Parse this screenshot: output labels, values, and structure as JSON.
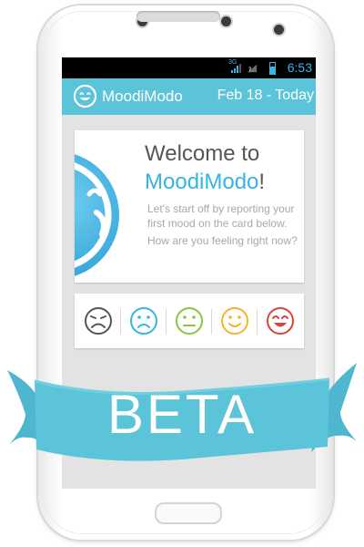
{
  "status_bar": {
    "network": "3G",
    "time": "6:53",
    "color": "#33b5e5"
  },
  "app_bar": {
    "title": "MoodiModo",
    "date": "Feb 18 - Today",
    "color": "#5cc4d8",
    "icon": "smiley-logo-icon"
  },
  "welcome_card": {
    "title_line1": "Welcome to",
    "title_app": "MoodiModo",
    "title_punct": "!",
    "body_line1": "Let's start off by reporting your first mood on the card below.",
    "body_line2": "How are you feeling right now?",
    "icon": "big-smiley-icon"
  },
  "mood_card": {
    "options": [
      {
        "name": "very-sad",
        "icon": "very-sad-face-icon",
        "color": "#555555"
      },
      {
        "name": "sad",
        "icon": "sad-face-icon",
        "color": "#33b5e5"
      },
      {
        "name": "neutral",
        "icon": "neutral-face-icon",
        "color": "#8cc63f"
      },
      {
        "name": "happy",
        "icon": "happy-face-icon",
        "color": "#f7b32b"
      },
      {
        "name": "very-happy",
        "icon": "very-happy-face-icon",
        "color": "#d9443b"
      }
    ]
  },
  "banner": {
    "text": "BETA",
    "color": "#5cc4d8"
  }
}
